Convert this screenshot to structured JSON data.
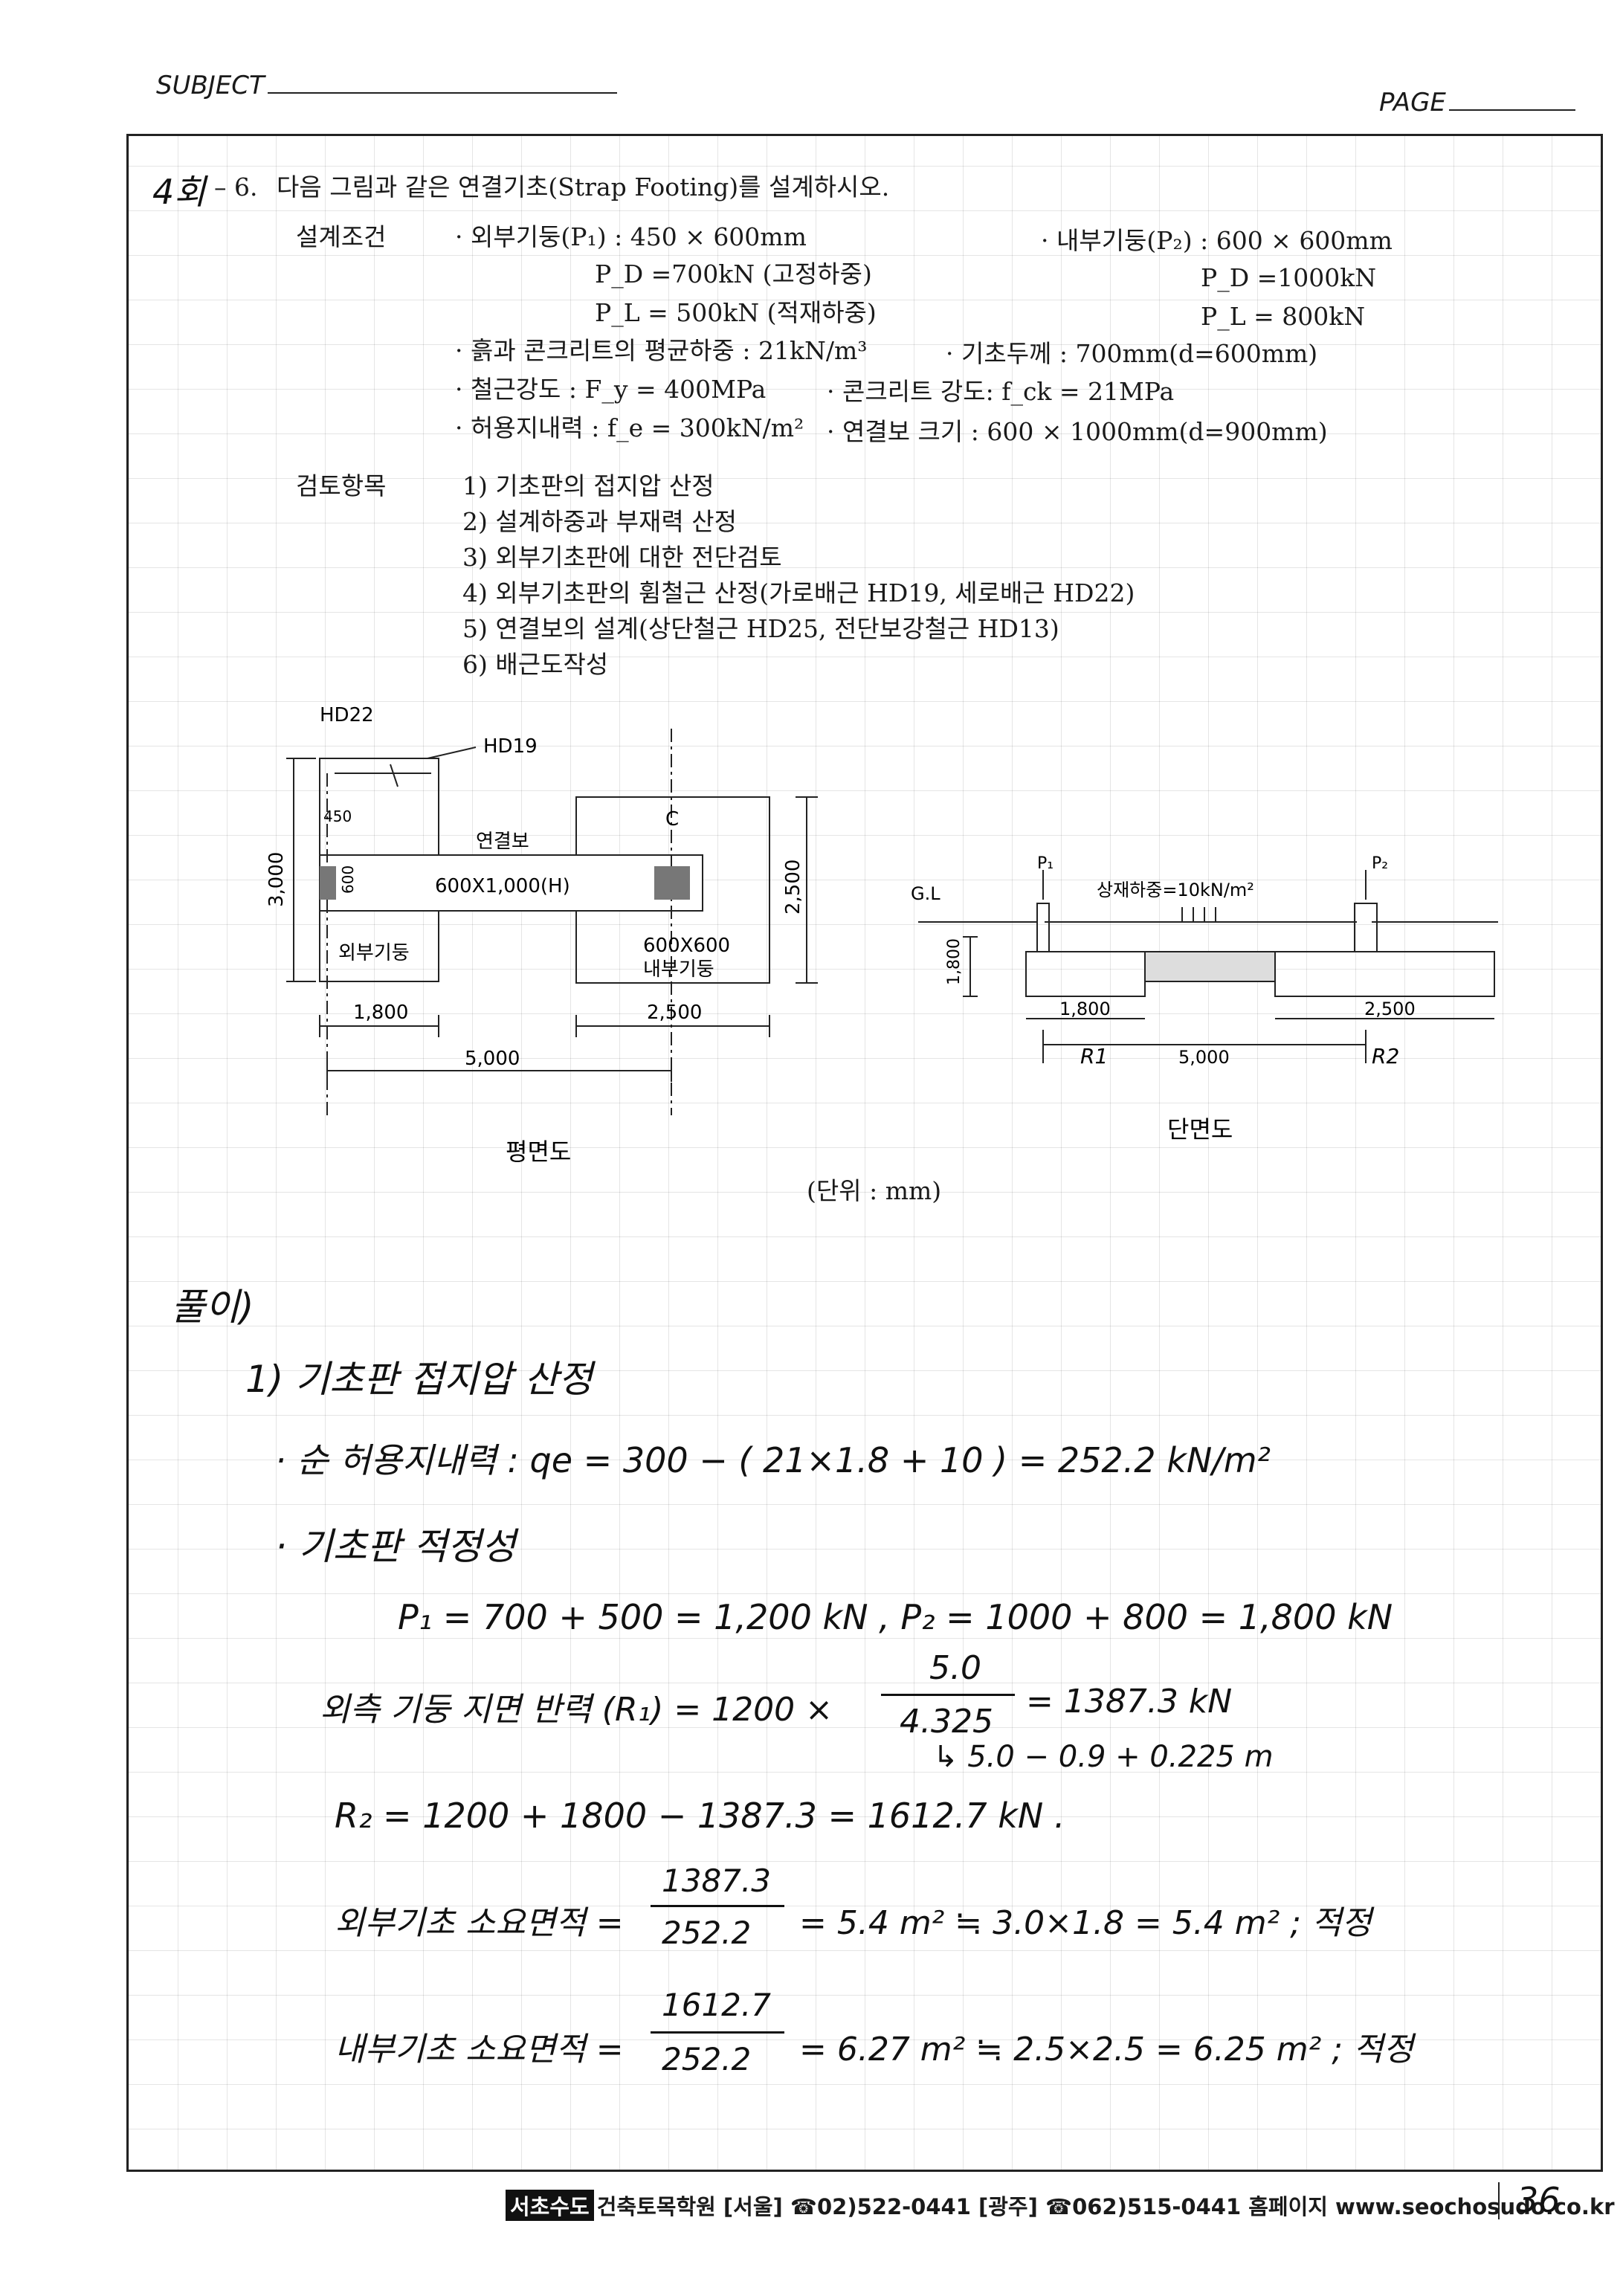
{
  "header": {
    "subject": "SUBJECT",
    "page": "PAGE"
  },
  "problem": {
    "mark": "4회",
    "number": "– 6.",
    "title": "다음 그림과 같은 연결기초(Strap Footing)를 설계하시오.",
    "conditions_label": "설계조건",
    "outer_column": "· 외부기둥(P₁) : 450 × 600mm",
    "outer_pd": "P_D =700kN (고정하중)",
    "outer_pl": "P_L = 500kN (적재하중)",
    "inner_column": "· 내부기둥(P₂) : 600 × 600mm",
    "inner_pd": "P_D =1000kN",
    "inner_pl": "P_L = 800kN",
    "soil_load": "· 흙과 콘크리트의 평균하중 : 21kN/m³",
    "footing_thickness": "· 기초두께 : 700mm(d=600mm)",
    "steel_strength": "· 철근강도 : F_y = 400MPa",
    "concrete_strength": "· 콘크리트 강도: f_ck = 21MPa",
    "bearing": "· 허용지내력 : f_e = 300kN/m²",
    "strap_size": "· 연결보 크기 : 600 × 1000mm(d=900mm)",
    "review_label": "검토항목",
    "review_items": [
      "1) 기초판의 접지압 산정",
      "2) 설계하중과 부재력 산정",
      "3) 외부기초판에 대한 전단검토",
      "4) 외부기초판의 휨철근 산정(가로배근 HD19, 세로배근 HD22)",
      "5) 연결보의 설계(상단철근 HD25, 전단보강철근 HD13)",
      "6) 배근도작성"
    ]
  },
  "plan": {
    "caption": "평면도",
    "hd22": "HD22",
    "hd19": "HD19",
    "dim_450": "450",
    "dim_600": "600",
    "dim_3000": "3,000",
    "dim_2500v": "2,500",
    "strap_label": "연결보",
    "strap_size": "600X1,000(H)",
    "outer_col_label": "외부기둥",
    "inner_col_size": "600X600",
    "inner_col_label": "내부기둥",
    "dim_1800": "1,800",
    "dim_2500": "2,500",
    "dim_5000": "5,000",
    "cl": "C"
  },
  "section": {
    "caption": "단면도",
    "gl": "G.L",
    "p1": "P₁",
    "p2": "P₂",
    "surcharge": "상재하중=10kN/m²",
    "dim_1800v": "1,800",
    "dim_1800": "1,800",
    "dim_2500": "2,500",
    "dim_5000": "5,000",
    "r1": "R1",
    "r2": "R2"
  },
  "unit_note": "(단위 : mm)",
  "solution": {
    "heading": "풀이)",
    "step1": "1)  기초판  접지압  산정",
    "line_net": "· 순 허용지내력 :  qe = 300 − ( 21×1.8 + 10 ) = 252.2 kN/m²",
    "line_adequacy": "· 기초판 적정성",
    "line_loads": "P₁ = 700 + 500 = 1,200 kN ,  P₂ = 1000 + 800 = 1,800 kN",
    "line_r1_label": "외측 기둥 지면 반력 (R₁) = 1200 ×",
    "line_r1_num": "5.0",
    "line_r1_den": "4.325",
    "line_r1_result": "= 1387.3 kN",
    "line_r1_note": "↳ 5.0 − 0.9 + 0.225 m",
    "line_r2": "R₂ = 1200 + 1800 − 1387.3 = 1612.7 kN .",
    "line_outer_label": "외부기초  소요면적 =",
    "line_outer_num": "1387.3",
    "line_outer_den": "252.2",
    "line_outer_result": "= 5.4 m²  ≒  3.0×1.8 = 5.4 m²  ; 적정",
    "line_inner_label": "내부기초  소요면적 =",
    "line_inner_num": "1612.7",
    "line_inner_den": "252.2",
    "line_inner_result": "= 6.27 m²  ≒  2.5×2.5 = 6.25 m²  ; 적정"
  },
  "footer": {
    "brand": "서초수도",
    "text": "건축토목학원 [서울] ☎02)522-0441 [광주] ☎062)515-0441 홈페이지 www.seochosudo.co.kr",
    "page_number": "36"
  }
}
